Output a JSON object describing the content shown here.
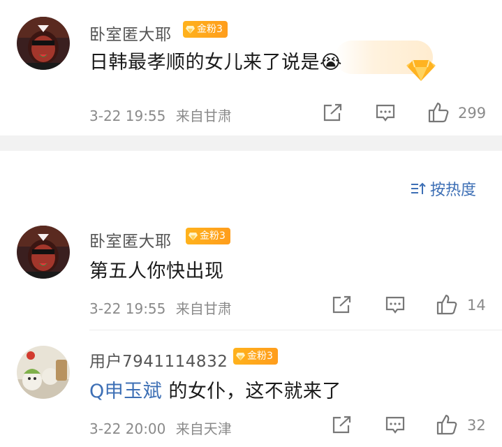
{
  "comments": [
    {
      "username": "卧室匿大耶",
      "badge": "金粉3",
      "text": "日韩最孝顺的女儿来了说是",
      "emoji": "😭",
      "time": "3-22 19:55",
      "location": "来自甘肃",
      "likes": "299"
    },
    {
      "username": "卧室匿大耶",
      "badge": "金粉3",
      "text": "第五人你快出现",
      "time": "3-22 19:55",
      "location": "来自甘肃",
      "likes": "14"
    },
    {
      "username": "用户7941114832",
      "badge": "金粉3",
      "mention": "Q申玉斌",
      "text": " 的女仆，这不就来了",
      "time": "3-22 20:00",
      "location": "来自天津",
      "likes": "32"
    }
  ],
  "sort": {
    "label": "按热度",
    "icon": "sort-icon"
  },
  "icons": {
    "share": "share-icon",
    "comment": "comment-icon",
    "like": "thumbs-up-icon",
    "badge": "gem-icon"
  },
  "colors": {
    "link": "#3d6fb5",
    "badge": "#ffa41c",
    "meta": "#8a8a8a"
  }
}
